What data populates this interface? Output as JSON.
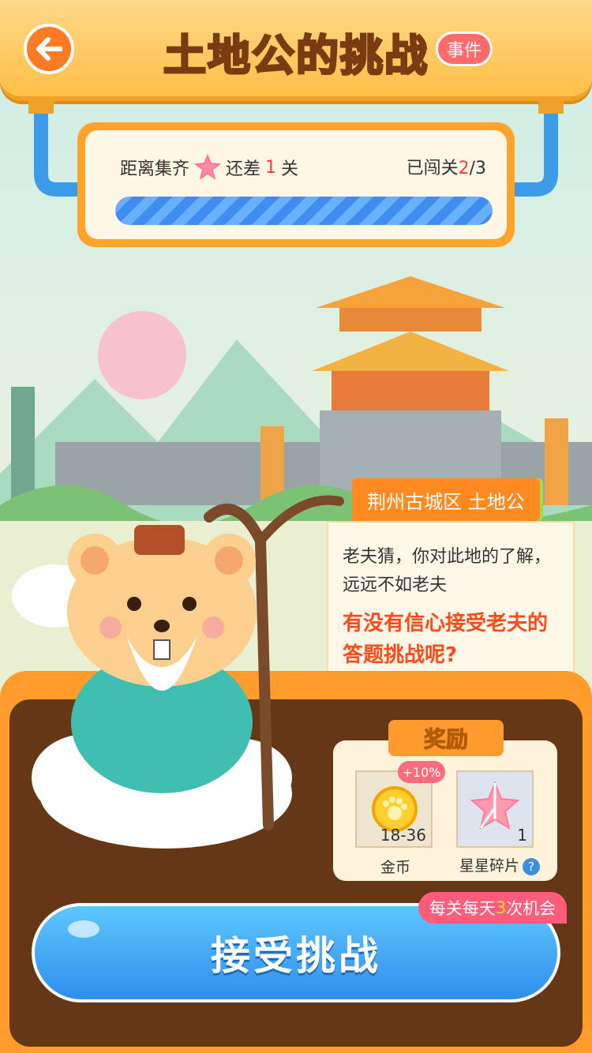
{
  "header": {
    "title": "土地公的挑战",
    "event_badge": "事件"
  },
  "progress": {
    "prefix": "距离集齐",
    "mid": "还差",
    "remaining": "1",
    "suffix": "关",
    "passed_label": "已闯关",
    "passed_count": "2",
    "passed_total": "/3",
    "fill_fraction": 1.0
  },
  "location": {
    "tag": "荆州古城区 土地公"
  },
  "dialog": {
    "text1": "老夫猜，你对此地的了解，远远不如老夫",
    "text2": "有没有信心接受老夫的答题挑战呢?"
  },
  "rewards": {
    "title": "奖励",
    "items": [
      {
        "label": "金币",
        "count": "18-36",
        "bonus": "+10%",
        "icon": "paw-coin-icon"
      },
      {
        "label": "星星碎片",
        "count": "1",
        "icon": "star-fragment-icon"
      }
    ]
  },
  "chance": {
    "prefix": "每关每天",
    "count": "3",
    "suffix": "次机会"
  },
  "accept_button": "接受挑战",
  "colors": {
    "accent_orange": "#ff9c2b",
    "button_blue": "#2f8fec",
    "alert_red": "#ff3a3a"
  }
}
